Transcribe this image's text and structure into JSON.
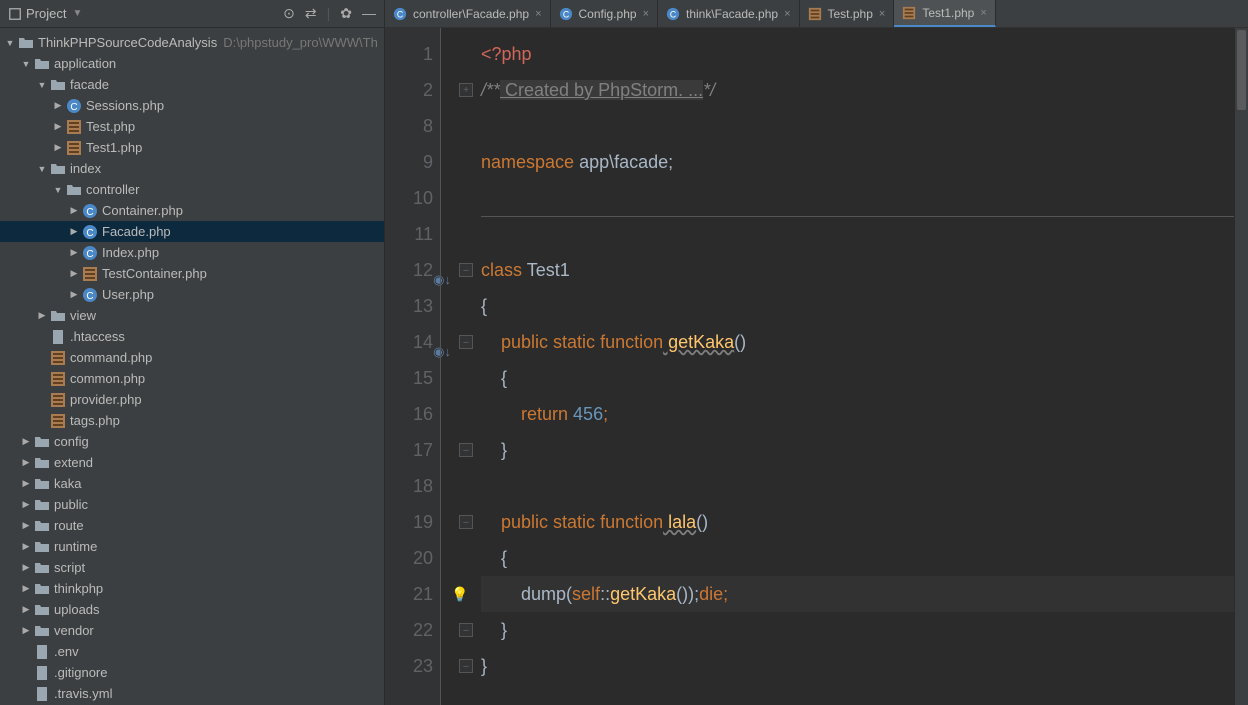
{
  "sidebar": {
    "title": "Project",
    "root": {
      "name": "ThinkPHPSourceCodeAnalysis",
      "path": "D:\\phpstudy_pro\\WWW\\Th"
    },
    "tree": [
      {
        "lvl": 0,
        "caret": "▼",
        "icon": "project",
        "name": "ThinkPHPSourceCodeAnalysis",
        "path": "D:\\phpstudy_pro\\WWW\\Th"
      },
      {
        "lvl": 1,
        "caret": "▼",
        "icon": "folder-open",
        "name": "application"
      },
      {
        "lvl": 2,
        "caret": "▼",
        "icon": "folder-open",
        "name": "facade"
      },
      {
        "lvl": 3,
        "caret": "▶",
        "icon": "php-c",
        "name": "Sessions.php"
      },
      {
        "lvl": 3,
        "caret": "▶",
        "icon": "php-t",
        "name": "Test.php"
      },
      {
        "lvl": 3,
        "caret": "▶",
        "icon": "php-t",
        "name": "Test1.php"
      },
      {
        "lvl": 2,
        "caret": "▼",
        "icon": "folder-open",
        "name": "index"
      },
      {
        "lvl": 3,
        "caret": "▼",
        "icon": "folder-open",
        "name": "controller"
      },
      {
        "lvl": 4,
        "caret": "▶",
        "icon": "php-c",
        "name": "Container.php"
      },
      {
        "lvl": 4,
        "caret": "▶",
        "icon": "php-c",
        "name": "Facade.php",
        "selected": true
      },
      {
        "lvl": 4,
        "caret": "▶",
        "icon": "php-c",
        "name": "Index.php"
      },
      {
        "lvl": 4,
        "caret": "▶",
        "icon": "php-t",
        "name": "TestContainer.php"
      },
      {
        "lvl": 4,
        "caret": "▶",
        "icon": "php-c",
        "name": "User.php"
      },
      {
        "lvl": 2,
        "caret": "▶",
        "icon": "folder",
        "name": "view"
      },
      {
        "lvl": 2,
        "caret": "",
        "icon": "file",
        "name": ".htaccess"
      },
      {
        "lvl": 2,
        "caret": "",
        "icon": "php-t",
        "name": "command.php"
      },
      {
        "lvl": 2,
        "caret": "",
        "icon": "php-t",
        "name": "common.php"
      },
      {
        "lvl": 2,
        "caret": "",
        "icon": "php-t",
        "name": "provider.php"
      },
      {
        "lvl": 2,
        "caret": "",
        "icon": "php-t",
        "name": "tags.php"
      },
      {
        "lvl": 1,
        "caret": "▶",
        "icon": "folder",
        "name": "config"
      },
      {
        "lvl": 1,
        "caret": "▶",
        "icon": "folder",
        "name": "extend"
      },
      {
        "lvl": 1,
        "caret": "▶",
        "icon": "folder",
        "name": "kaka"
      },
      {
        "lvl": 1,
        "caret": "▶",
        "icon": "folder",
        "name": "public"
      },
      {
        "lvl": 1,
        "caret": "▶",
        "icon": "folder",
        "name": "route"
      },
      {
        "lvl": 1,
        "caret": "▶",
        "icon": "folder",
        "name": "runtime"
      },
      {
        "lvl": 1,
        "caret": "▶",
        "icon": "folder",
        "name": "script"
      },
      {
        "lvl": 1,
        "caret": "▶",
        "icon": "folder",
        "name": "thinkphp"
      },
      {
        "lvl": 1,
        "caret": "▶",
        "icon": "folder",
        "name": "uploads"
      },
      {
        "lvl": 1,
        "caret": "▶",
        "icon": "folder",
        "name": "vendor"
      },
      {
        "lvl": 1,
        "caret": "",
        "icon": "file",
        "name": ".env"
      },
      {
        "lvl": 1,
        "caret": "",
        "icon": "file",
        "name": ".gitignore"
      },
      {
        "lvl": 1,
        "caret": "",
        "icon": "file",
        "name": ".travis.yml"
      }
    ]
  },
  "tabs": [
    {
      "icon": "php-c",
      "label": "controller\\Facade.php",
      "active": false
    },
    {
      "icon": "php-c",
      "label": "Config.php",
      "active": false
    },
    {
      "icon": "php-c",
      "label": "think\\Facade.php",
      "active": false
    },
    {
      "icon": "php-t",
      "label": "Test.php",
      "active": false
    },
    {
      "icon": "php-t",
      "label": "Test1.php",
      "active": true
    }
  ],
  "code": {
    "lineNumbers": [
      "1",
      "2",
      "8",
      "9",
      "10",
      "11",
      "12",
      "13",
      "14",
      "15",
      "16",
      "17",
      "18",
      "19",
      "20",
      "21",
      "22",
      "23"
    ],
    "lines": {
      "l1": "<?php",
      "l2_a": "/**",
      "l2_b": " Created by PhpStorm. ...",
      "l2_c": "*/",
      "l9_a": "namespace",
      "l9_b": " app\\facade;",
      "l12_a": "class",
      "l12_b": " Test1",
      "l13": "{",
      "l14_a": "public",
      "l14_b": " static",
      "l14_c": " function",
      "l14_d": " getKaka",
      "l14_e": "()",
      "l15": "{",
      "l16_a": "return",
      "l16_b": " 456",
      "l16_c": ";",
      "l17": "}",
      "l19_a": "public",
      "l19_b": " static",
      "l19_c": " function",
      "l19_d": " lala",
      "l19_e": "()",
      "l20": "{",
      "l21_a": "dump(",
      "l21_b": "self",
      "l21_c": "::",
      "l21_d": "getKaka",
      "l21_e": "());",
      "l21_f": "die",
      "l21_g": ";",
      "l22": "}",
      "l23": "}"
    }
  }
}
